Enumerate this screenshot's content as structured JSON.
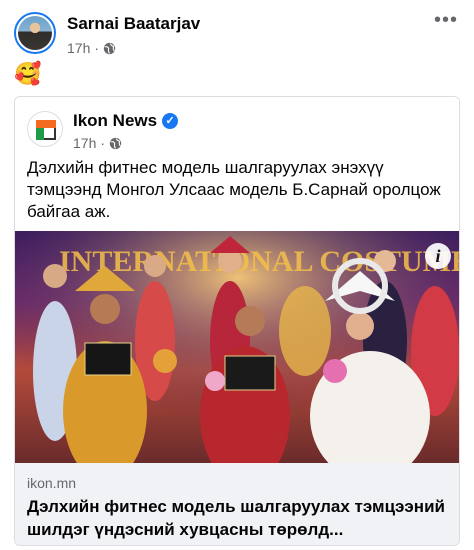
{
  "post": {
    "author": "Sarnai Baatarjav",
    "time": "17h",
    "separator": "·",
    "privacy_icon": "globe-icon",
    "emoji": "🥰"
  },
  "shared": {
    "page_name": "Ikon News",
    "verified_icon": "verified-badge-icon",
    "time": "17h",
    "separator": "·",
    "text": "Дэлхийн фитнес модель шалгаруулах энэхүү тэмцээнд Монгол Улсаас модель Б.Сарнай оролцож байгаа аж.",
    "photo_banner_text": "INTERNATIONAL COSTUME",
    "info_symbol": "i"
  },
  "link": {
    "domain": "ikon.mn",
    "title": "Дэлхийн фитнес модель шалгаруулах тэмцээний шилдэг үндэсний хувцасны төрөлд..."
  },
  "colors": {
    "accent": "#1877f2",
    "secondary_text": "#65676b",
    "link_background": "#f0f2f5"
  }
}
